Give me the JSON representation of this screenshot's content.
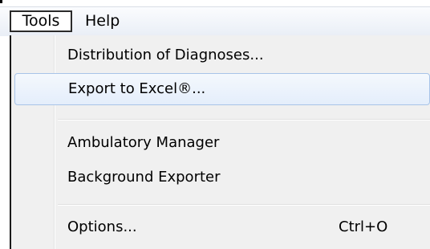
{
  "menubar": {
    "menus": [
      {
        "label": "Tools"
      },
      {
        "label": "Help"
      }
    ]
  },
  "dropdown": {
    "items": [
      {
        "label": "Distribution of Diagnoses...",
        "shortcut": ""
      },
      {
        "label": "Export to Excel®...",
        "shortcut": "",
        "highlighted": true
      },
      {
        "label": "Ambulatory Manager",
        "shortcut": ""
      },
      {
        "label": "Background Exporter",
        "shortcut": ""
      },
      {
        "label": "Options...",
        "shortcut": "Ctrl+O"
      }
    ]
  },
  "colors": {
    "highlight_border": "#a8c4e8",
    "highlight_fill": "#e4eefb",
    "menu_background": "#f0f0f0"
  }
}
